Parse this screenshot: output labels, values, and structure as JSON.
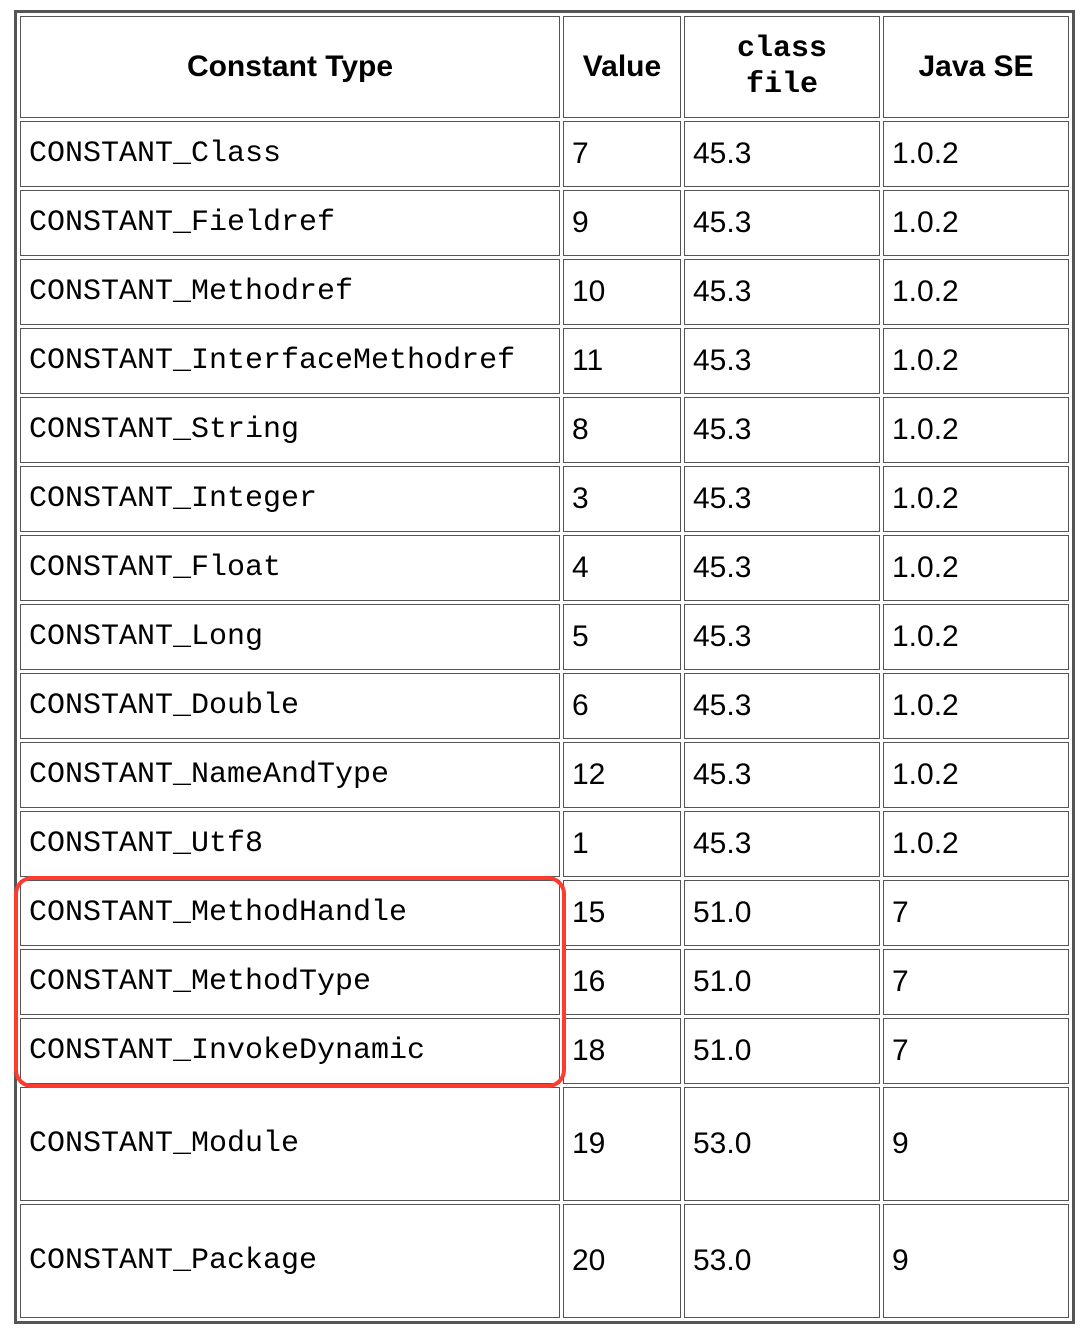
{
  "headers": {
    "constant_type": "Constant Type",
    "value": "Value",
    "class_file": "class file",
    "java_se": "Java SE"
  },
  "rows": [
    {
      "type": "CONSTANT_Class",
      "value": "7",
      "class_file": "45.3",
      "java_se": "1.0.2",
      "highlighted": false,
      "tall": false
    },
    {
      "type": "CONSTANT_Fieldref",
      "value": "9",
      "class_file": "45.3",
      "java_se": "1.0.2",
      "highlighted": false,
      "tall": false
    },
    {
      "type": "CONSTANT_Methodref",
      "value": "10",
      "class_file": "45.3",
      "java_se": "1.0.2",
      "highlighted": false,
      "tall": false
    },
    {
      "type": "CONSTANT_InterfaceMethodref",
      "value": "11",
      "class_file": "45.3",
      "java_se": "1.0.2",
      "highlighted": false,
      "tall": false
    },
    {
      "type": "CONSTANT_String",
      "value": "8",
      "class_file": "45.3",
      "java_se": "1.0.2",
      "highlighted": false,
      "tall": false
    },
    {
      "type": "CONSTANT_Integer",
      "value": "3",
      "class_file": "45.3",
      "java_se": "1.0.2",
      "highlighted": false,
      "tall": false
    },
    {
      "type": "CONSTANT_Float",
      "value": "4",
      "class_file": "45.3",
      "java_se": "1.0.2",
      "highlighted": false,
      "tall": false
    },
    {
      "type": "CONSTANT_Long",
      "value": "5",
      "class_file": "45.3",
      "java_se": "1.0.2",
      "highlighted": false,
      "tall": false
    },
    {
      "type": "CONSTANT_Double",
      "value": "6",
      "class_file": "45.3",
      "java_se": "1.0.2",
      "highlighted": false,
      "tall": false
    },
    {
      "type": "CONSTANT_NameAndType",
      "value": "12",
      "class_file": "45.3",
      "java_se": "1.0.2",
      "highlighted": false,
      "tall": false
    },
    {
      "type": "CONSTANT_Utf8",
      "value": "1",
      "class_file": "45.3",
      "java_se": "1.0.2",
      "highlighted": false,
      "tall": false
    },
    {
      "type": "CONSTANT_MethodHandle",
      "value": "15",
      "class_file": "51.0",
      "java_se": "7",
      "highlighted": true,
      "tall": false
    },
    {
      "type": "CONSTANT_MethodType",
      "value": "16",
      "class_file": "51.0",
      "java_se": "7",
      "highlighted": true,
      "tall": false
    },
    {
      "type": "CONSTANT_InvokeDynamic",
      "value": "18",
      "class_file": "51.0",
      "java_se": "7",
      "highlighted": true,
      "tall": false
    },
    {
      "type": "CONSTANT_Module",
      "value": "19",
      "class_file": "53.0",
      "java_se": "9",
      "highlighted": false,
      "tall": true
    },
    {
      "type": "CONSTANT_Package",
      "value": "20",
      "class_file": "53.0",
      "java_se": "9",
      "highlighted": false,
      "tall": true
    }
  ],
  "annotation": {
    "highlight_color": "#ff3b30"
  }
}
